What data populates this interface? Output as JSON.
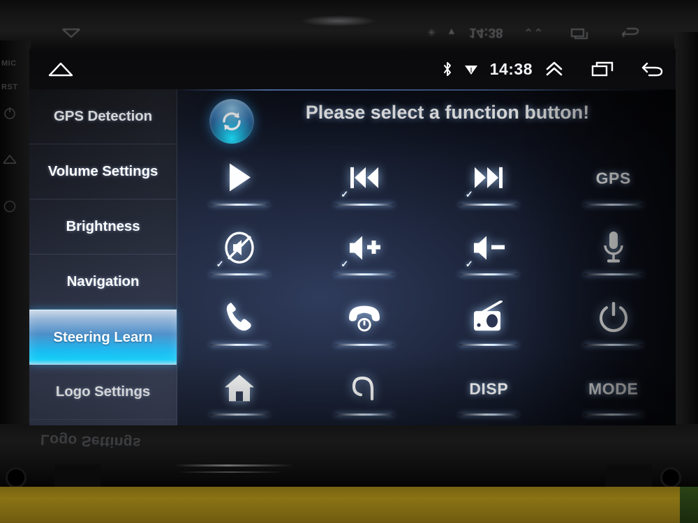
{
  "device": {
    "bezel_labels": [
      "MIC",
      "RST"
    ],
    "bezel_icons": [
      "power-icon",
      "home-icon"
    ],
    "bottom_reflection_text": "Logo Settings"
  },
  "statusbar": {
    "home_icon": "home-icon",
    "bluetooth_icon": "bluetooth-icon",
    "wifi_icon": "wifi-icon",
    "time": "14:38",
    "chevron_up_icon": "chevron-double-up-icon",
    "recents_icon": "recent-apps-icon",
    "back_icon": "back-arrow-icon"
  },
  "sidebar": {
    "items": [
      {
        "label": "GPS Detection",
        "selected": false
      },
      {
        "label": "Volume Settings",
        "selected": false
      },
      {
        "label": "Brightness",
        "selected": false
      },
      {
        "label": "Navigation",
        "selected": false
      },
      {
        "label": "Steering Learn",
        "selected": true
      },
      {
        "label": "Logo Settings",
        "selected": false
      }
    ]
  },
  "header": {
    "sync_icon": "sync-refresh-icon",
    "title": "Please select a function button!"
  },
  "colors": {
    "accent_cyan": "#0fd4ff",
    "accent_blue": "#4d8fc9",
    "screen_bg": "#1b2338",
    "text_white": "#ffffff"
  },
  "grid": {
    "rows": 4,
    "cols": 4,
    "buttons": [
      {
        "icon": "play-icon",
        "label": "",
        "learned": false
      },
      {
        "icon": "previous-track-icon",
        "label": "",
        "learned": true
      },
      {
        "icon": "next-track-icon",
        "label": "",
        "learned": true
      },
      {
        "icon": "",
        "label": "GPS",
        "learned": false
      },
      {
        "icon": "mute-icon",
        "label": "",
        "learned": true
      },
      {
        "icon": "volume-up-icon",
        "label": "",
        "learned": true
      },
      {
        "icon": "volume-down-icon",
        "label": "",
        "learned": true
      },
      {
        "icon": "microphone-icon",
        "label": "",
        "learned": false
      },
      {
        "icon": "phone-answer-icon",
        "label": "",
        "learned": false
      },
      {
        "icon": "phone-hangup-icon",
        "label": "",
        "learned": false
      },
      {
        "icon": "radio-icon",
        "label": "",
        "learned": false
      },
      {
        "icon": "power-icon",
        "label": "",
        "learned": false
      },
      {
        "icon": "home-icon",
        "label": "",
        "learned": false
      },
      {
        "icon": "return-back-icon",
        "label": "",
        "learned": false
      },
      {
        "icon": "",
        "label": "DISP",
        "learned": false
      },
      {
        "icon": "",
        "label": "MODE",
        "learned": false
      }
    ],
    "check_mark": "✓"
  }
}
